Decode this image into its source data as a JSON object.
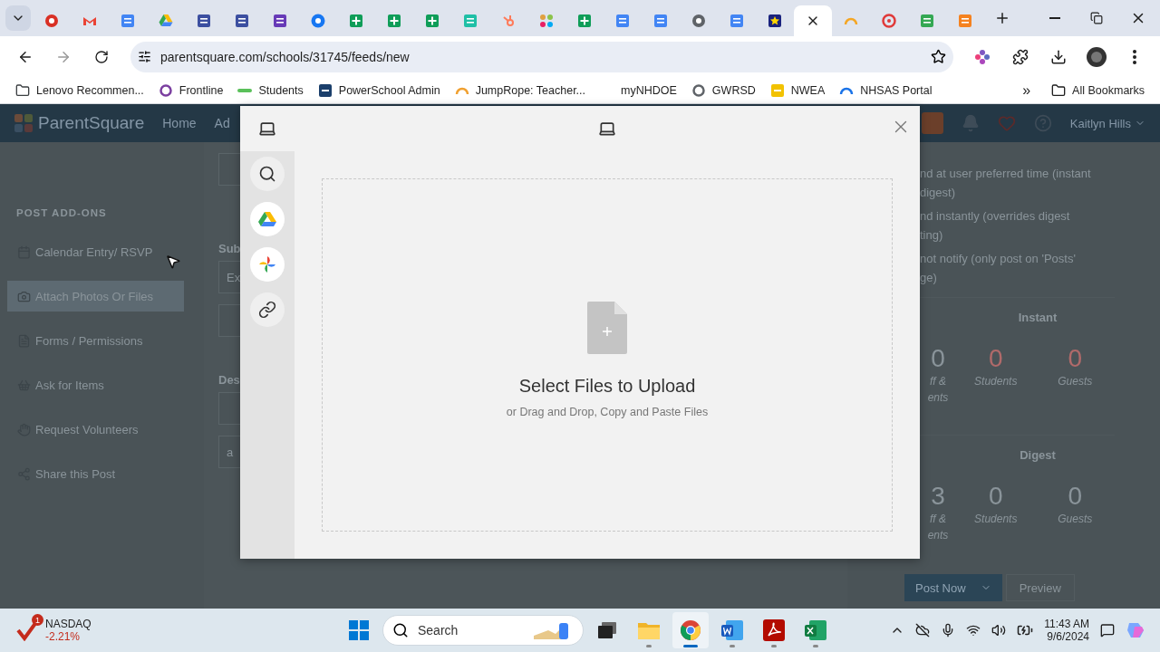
{
  "browser": {
    "tabs": [
      {
        "kind": "record",
        "selected": false
      },
      {
        "kind": "mail",
        "selected": false
      },
      {
        "kind": "calendar",
        "selected": false
      },
      {
        "kind": "drive",
        "selected": false
      },
      {
        "kind": "form",
        "selected": false
      },
      {
        "kind": "form",
        "selected": false
      },
      {
        "kind": "list",
        "selected": false
      },
      {
        "kind": "social",
        "selected": false
      },
      {
        "kind": "sheet",
        "selected": false
      },
      {
        "kind": "sheet",
        "selected": false
      },
      {
        "kind": "sheet",
        "selected": false
      },
      {
        "kind": "tile",
        "selected": false
      },
      {
        "kind": "sprocket",
        "selected": false
      },
      {
        "kind": "dots",
        "selected": false
      },
      {
        "kind": "sheet",
        "selected": false
      },
      {
        "kind": "doc",
        "selected": false
      },
      {
        "kind": "doc",
        "selected": false
      },
      {
        "kind": "globe",
        "selected": false
      },
      {
        "kind": "doc",
        "selected": false
      },
      {
        "kind": "star",
        "selected": false
      },
      {
        "selected": true
      },
      {
        "kind": "arc",
        "selected": false
      },
      {
        "kind": "wheel",
        "selected": false
      },
      {
        "kind": "green",
        "selected": false
      },
      {
        "kind": "orange",
        "selected": false
      }
    ],
    "url": "parentsquare.com/schools/31745/feeds/new",
    "bookmarks": [
      {
        "label": "Lenovo Recommen...",
        "kind": "folder",
        "color": "#3c4043"
      },
      {
        "label": "Frontline",
        "kind": "ring",
        "color": "#7b3fa0"
      },
      {
        "label": "Students",
        "kind": "dash",
        "color": "#5ac05a"
      },
      {
        "label": "PowerSchool Admin",
        "kind": "square",
        "color": "#1b3f6b"
      },
      {
        "label": "JumpRope: Teacher...",
        "kind": "arc",
        "color": "#f0a030"
      },
      {
        "label": "myNHDOE",
        "kind": "blank"
      },
      {
        "label": "GWRSD",
        "kind": "ring",
        "color": "#5f6368"
      },
      {
        "label": "NWEA",
        "kind": "square",
        "color": "#f2c200"
      },
      {
        "label": "NHSAS Portal",
        "kind": "arc",
        "color": "#1a73e8"
      }
    ],
    "overflow": "»",
    "all_bookmarks": "All Bookmarks"
  },
  "app": {
    "brand": "ParentSquare",
    "nav": [
      "Home",
      "Ad"
    ],
    "user": "Kaitlyn Hills",
    "sidebar": {
      "heading": "POST ADD-ONS",
      "items": [
        {
          "label": "Calendar Entry/ RSVP",
          "kind": "calendar",
          "selected": false
        },
        {
          "label": "Attach Photos Or Files",
          "kind": "camera",
          "selected": true
        },
        {
          "label": "Forms / Permissions",
          "kind": "form",
          "selected": false
        },
        {
          "label": "Ask for Items",
          "kind": "basket",
          "selected": false
        },
        {
          "label": "Request Volunteers",
          "kind": "hand",
          "selected": false
        },
        {
          "label": "Share this Post",
          "kind": "share",
          "selected": false
        }
      ]
    },
    "form": {
      "subject_label": "Sub",
      "subject_placeholder": "Ex",
      "description_label": "Des",
      "description_placeholder": "a"
    },
    "delivery": {
      "options": [
        {
          "lines": [
            "nd at user preferred time (instant",
            "digest)"
          ]
        },
        {
          "lines": [
            "nd instantly (overrides digest",
            "ting)"
          ]
        },
        {
          "lines": [
            "not notify (only post on 'Posts'",
            "ge)"
          ]
        }
      ],
      "groups": [
        {
          "title": "Instant",
          "stats": [
            {
              "value": "0",
              "label": "ff & ents",
              "color": "#8a949a"
            },
            {
              "value": "0",
              "label": "Students",
              "color": "#b06a6a"
            },
            {
              "value": "0",
              "label": "Guests",
              "color": "#b06a6a"
            }
          ]
        },
        {
          "title": "Digest",
          "stats": [
            {
              "value": "3",
              "label": "ff & ents",
              "color": "#8a949a"
            },
            {
              "value": "0",
              "label": "Students",
              "color": "#8a949a"
            },
            {
              "value": "0",
              "label": "Guests",
              "color": "#8a949a"
            }
          ]
        }
      ]
    },
    "actions": {
      "primary": "Post Now",
      "secondary": "Preview"
    }
  },
  "dialog": {
    "sources": [
      {
        "kind": "device",
        "selected": true
      },
      {
        "kind": "search",
        "selected": false
      },
      {
        "kind": "drive",
        "selected": false
      },
      {
        "kind": "photos",
        "selected": false
      },
      {
        "kind": "link",
        "selected": false
      }
    ],
    "title": "Select Files to Upload",
    "hint": "or Drag and Drop, Copy and Paste Files"
  },
  "taskbar": {
    "widget": {
      "badge": "1",
      "name": "NASDAQ",
      "change": "-2.21%"
    },
    "search": {
      "placeholder": "Search"
    },
    "apps": [
      {
        "kind": "taskview",
        "running": false,
        "selected": false
      },
      {
        "kind": "explorer",
        "running": true,
        "selected": false
      },
      {
        "kind": "chrome",
        "running": true,
        "selected": true
      },
      {
        "kind": "word",
        "running": true,
        "selected": false
      },
      {
        "kind": "acrobat",
        "running": true,
        "selected": false
      },
      {
        "kind": "excel",
        "running": true,
        "selected": false
      }
    ],
    "time": "11:43 AM",
    "date": "9/6/2024"
  }
}
